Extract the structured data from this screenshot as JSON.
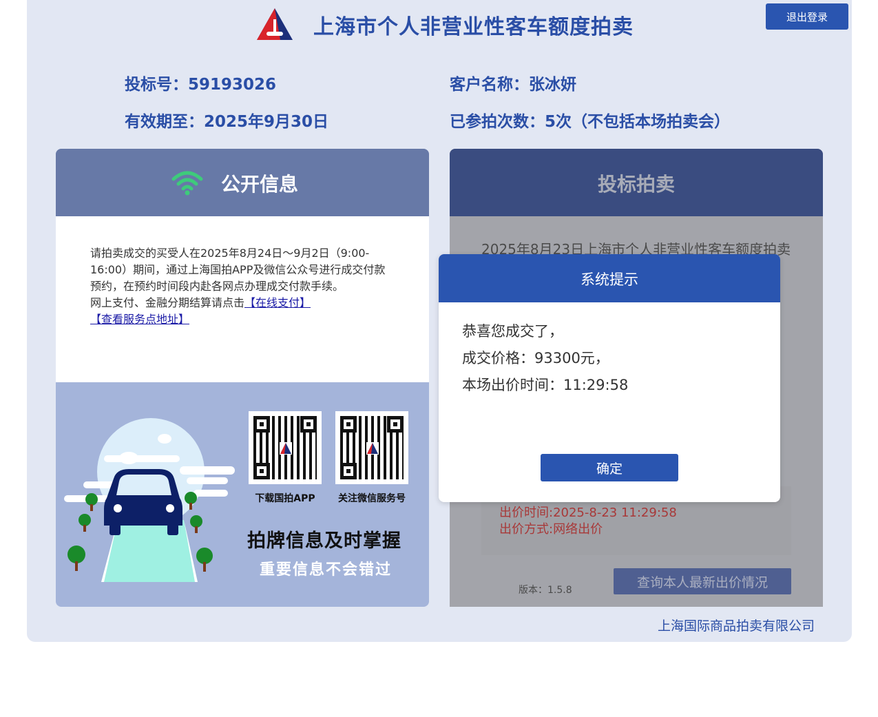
{
  "header": {
    "title": "上海市个人非营业性客车额度拍卖",
    "logout_label": "退出登录",
    "logo_icon": "auction-logo-icon"
  },
  "bidder": {
    "bid_number_label": "投标号：",
    "bid_number": "59193026",
    "customer_label": "客户名称：",
    "customer_name": "张冰妍",
    "valid_until_label": "有效期至：",
    "valid_until": "2025年9月30日",
    "participations_label": "已参拍次数：",
    "participations": "5次（不包括本场拍卖会）"
  },
  "public_info": {
    "title": "公开信息",
    "icon": "wifi-icon",
    "notice_text": "请拍卖成交的买受人在2025年8月24日～9月2日（9:00-16:00）期间，通过上海国拍APP及微信公众号进行成交付款预约，在预约时间段内赴各网点办理成交付款手续。",
    "payment_prefix": "网上支付、金融分期结算请点击",
    "online_pay_link": "【在线支付】",
    "service_link": "【查看服务点地址】",
    "qr_app_label": "下载国拍APP",
    "qr_wechat_label": "关注微信服务号",
    "promo_line1": "拍牌信息及时掌握",
    "promo_line2": "重要信息不会错过"
  },
  "bidding": {
    "title": "投标拍卖",
    "auction_title": "2025年8月23日上海市个人非营业性客车额度拍卖",
    "bid_time": "出价时间:2025-8-23 11:29:58",
    "bid_method": "出价方式:网络出价",
    "version": "版本：1.5.8",
    "query_label": "查询本人最新出价情况"
  },
  "modal": {
    "title": "系统提示",
    "line1": "恭喜您成交了，",
    "line2": "成交价格：93300元，",
    "line3": "本场出价时间：11:29:58",
    "ok_label": "确定"
  },
  "footer": {
    "company": "上海国际商品拍卖有限公司"
  },
  "colors": {
    "primary": "#2a55b0",
    "title_text": "#2a4ea6",
    "frame_bg": "#e2e7f3",
    "left_head": "#6779a7",
    "right_head": "#3a4c80",
    "wifi_green": "#3ecb7b",
    "bid_red": "#a83838"
  }
}
